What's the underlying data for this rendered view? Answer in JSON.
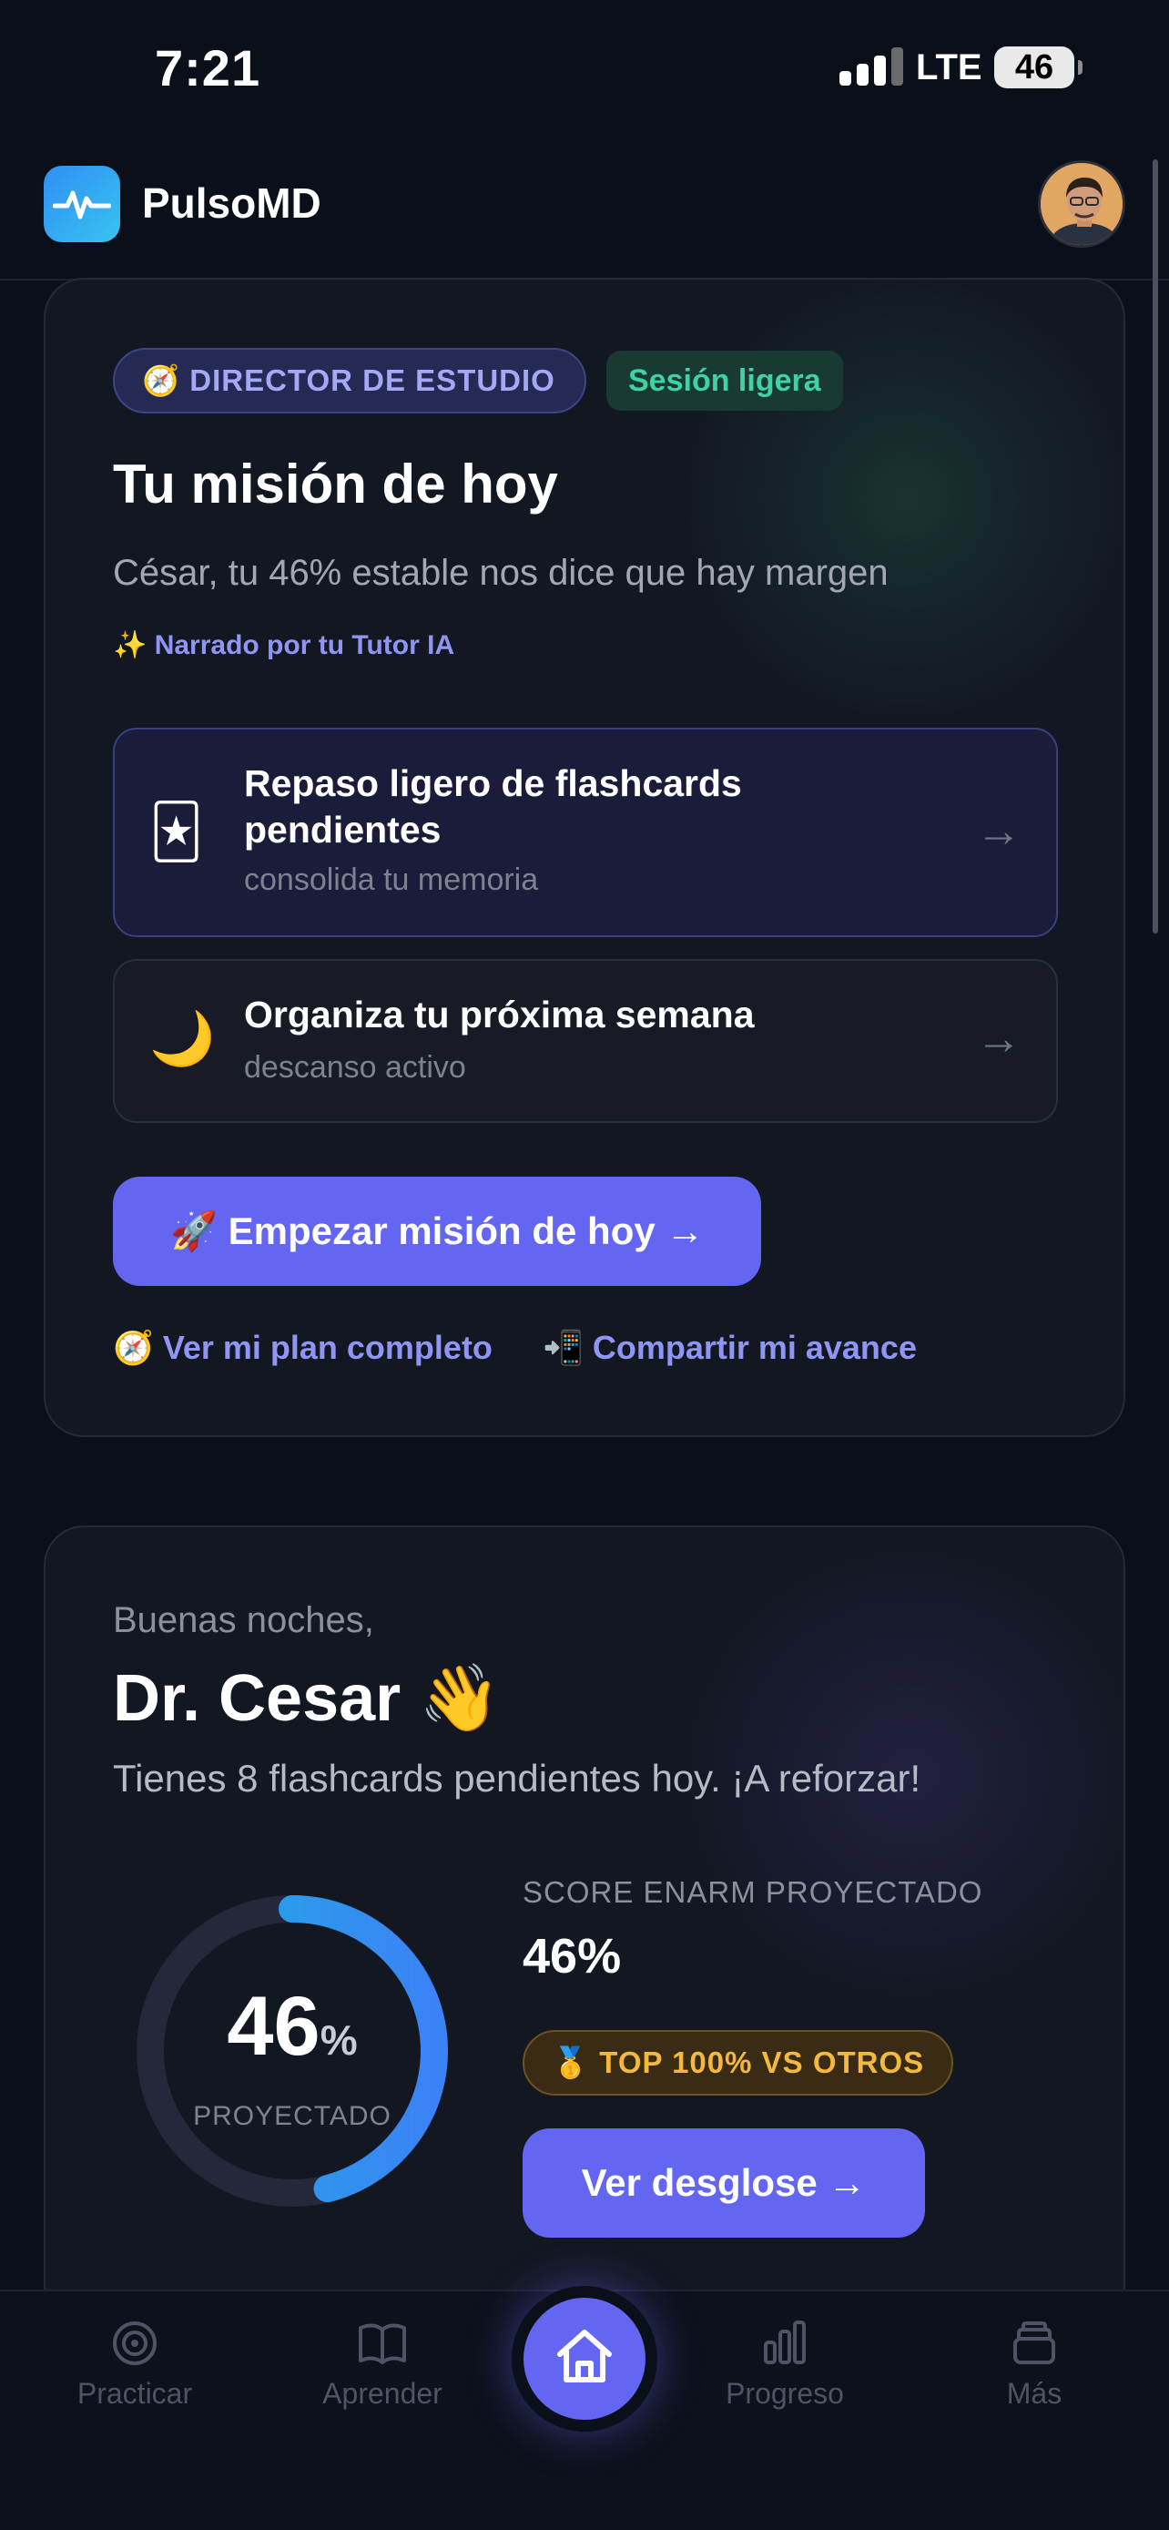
{
  "status_bar": {
    "time": "7:21",
    "network": "LTE",
    "battery": "46"
  },
  "header": {
    "brand": "PulsoMD"
  },
  "mission": {
    "badge": "🧭 DIRECTOR DE ESTUDIO",
    "session": "Sesión ligera",
    "title": "Tu misión de hoy",
    "subtitle": "César, tu 46% estable nos dice que hay margen",
    "narrator": "✨ Narrado por tu Tutor IA",
    "tasks": [
      {
        "icon": "🃏",
        "title": "Repaso ligero de flashcards pendientes",
        "meta": "consolida tu memoria",
        "arrow": "→"
      },
      {
        "icon": "🌙",
        "title": "Organiza tu próxima semana",
        "meta": "descanso activo",
        "arrow": "→"
      }
    ],
    "cta": "🚀 Empezar misión de hoy →",
    "link_plan": "🧭 Ver mi plan completo",
    "link_share": "📲 Compartir mi avance"
  },
  "greeting": {
    "small": "Buenas noches,",
    "name": "Dr. Cesar 👋",
    "subtitle": "Tienes 8 flashcards pendientes hoy. ¡A reforzar!",
    "ring_value": "46",
    "ring_pct": "%",
    "ring_label": "PROYECTADO",
    "ring_progress": 0.46,
    "score_label": "SCORE ENARM PROYECTADO",
    "score_value": "46%",
    "top_badge": "🥇 TOP 100% VS OTROS",
    "cta": "Ver desglose →"
  },
  "nav": {
    "items": [
      {
        "label": "Practicar",
        "icon": "target-icon"
      },
      {
        "label": "Aprender",
        "icon": "book-icon"
      },
      {
        "label": "Inicio",
        "icon": "home-icon"
      },
      {
        "label": "Progreso",
        "icon": "bar-chart-icon"
      },
      {
        "label": "Más",
        "icon": "stack-icon"
      }
    ]
  },
  "colors": {
    "accent": "#6366f1",
    "teal": "#3ed3a0",
    "gold": "#f4b740",
    "ring_start": "#1fb0e0",
    "ring_end": "#3b82f6"
  }
}
